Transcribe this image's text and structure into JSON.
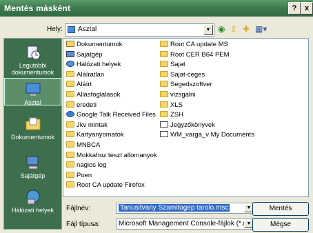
{
  "title": "Mentés másként",
  "title_buttons": {
    "help": "?",
    "close": "x"
  },
  "location": {
    "label": "Hely:",
    "value": "Asztal"
  },
  "places": [
    {
      "label": "Legutóbbi dokumentumok"
    },
    {
      "label": "Asztal"
    },
    {
      "label": "Dokumentumok"
    },
    {
      "label": "Sajátgép"
    },
    {
      "label": "Hálózati helyek"
    }
  ],
  "files_col1": [
    {
      "name": "Dokumentumok",
      "icon": "documents-folder-icon"
    },
    {
      "name": "Sajátgép",
      "icon": "computer-icon"
    },
    {
      "name": "Hálózati helyek",
      "icon": "network-icon"
    },
    {
      "name": "Aláíratlan",
      "icon": "folder-icon"
    },
    {
      "name": "Aláírt",
      "icon": "folder-icon"
    },
    {
      "name": "Allasfoglalasok",
      "icon": "folder-icon"
    },
    {
      "name": "eredeti",
      "icon": "folder-icon"
    },
    {
      "name": "Google Talk Received Files",
      "icon": "special-folder-icon"
    },
    {
      "name": "Jkv mintak",
      "icon": "folder-icon"
    },
    {
      "name": "Kartyanyomatok",
      "icon": "folder-icon"
    },
    {
      "name": "MNBCA",
      "icon": "folder-icon"
    },
    {
      "name": "Mokkahoz teszt allomanyok",
      "icon": "folder-icon"
    },
    {
      "name": "nagios log",
      "icon": "folder-icon"
    },
    {
      "name": "Poen",
      "icon": "folder-icon"
    },
    {
      "name": "Root CA update Firefox",
      "icon": "folder-icon"
    }
  ],
  "files_col2": [
    {
      "name": "Root CA update MS",
      "icon": "folder-icon"
    },
    {
      "name": "Root CER B64 PEM",
      "icon": "folder-icon"
    },
    {
      "name": "Sajat",
      "icon": "folder-icon"
    },
    {
      "name": "Sajat-ceges",
      "icon": "folder-icon"
    },
    {
      "name": "Segedszoftver",
      "icon": "folder-icon"
    },
    {
      "name": "vizsgalni",
      "icon": "folder-icon"
    },
    {
      "name": "XLS",
      "icon": "folder-icon"
    },
    {
      "name": "ZSH",
      "icon": "folder-icon"
    },
    {
      "name": "Jegyzőkönyvek",
      "icon": "shortcut-icon"
    },
    {
      "name": "WM_varga_v My Documents",
      "icon": "shortcut-icon"
    }
  ],
  "filename": {
    "label": "Fájlnév:",
    "value": "Tanusitvany Szamitogep tarolo.msc"
  },
  "filetype": {
    "label": "Fájl típusa:",
    "value": "Microsoft Management Console-fájlok (*.msc)"
  },
  "buttons": {
    "save": "Mentés",
    "cancel": "Mégse"
  },
  "colors": {
    "titlebar": "#3f7b50",
    "sidebar": "#3d6f4d",
    "folder": "#f3d66a"
  }
}
